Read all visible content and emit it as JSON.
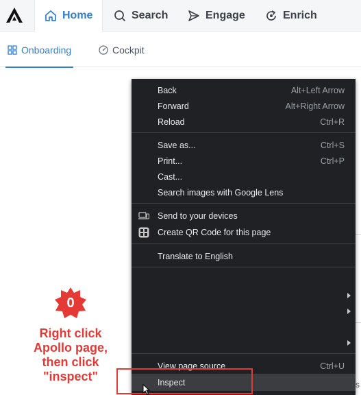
{
  "top_nav": {
    "tabs": [
      {
        "label": "Home",
        "icon": "home-icon",
        "active": true
      },
      {
        "label": "Search",
        "icon": "search-icon",
        "active": false
      },
      {
        "label": "Engage",
        "icon": "send-icon",
        "active": false
      },
      {
        "label": "Enrich",
        "icon": "refresh-icon",
        "active": false
      }
    ]
  },
  "sub_nav": {
    "tabs": [
      {
        "label": "Onboarding",
        "icon": "grid-icon",
        "active": true
      },
      {
        "label": "Cockpit",
        "icon": "gauge-icon",
        "active": false
      }
    ]
  },
  "context_menu": {
    "items": {
      "back": {
        "label": "Back",
        "shortcut": "Alt+Left Arrow"
      },
      "forward": {
        "label": "Forward",
        "shortcut": "Alt+Right Arrow"
      },
      "reload": {
        "label": "Reload",
        "shortcut": "Ctrl+R"
      },
      "save_as": {
        "label": "Save as...",
        "shortcut": "Ctrl+S"
      },
      "print": {
        "label": "Print...",
        "shortcut": "Ctrl+P"
      },
      "cast": {
        "label": "Cast..."
      },
      "lens": {
        "label": "Search images with Google Lens"
      },
      "send_devices": {
        "label": "Send to your devices",
        "icon": "devices-icon"
      },
      "qr": {
        "label": "Create QR Code for this page",
        "icon": "qr-code-icon"
      },
      "translate": {
        "label": "Translate to English"
      },
      "view_source": {
        "label": "View page source",
        "shortcut": "Ctrl+U"
      },
      "inspect": {
        "label": "Inspect"
      }
    }
  },
  "annotation": {
    "step_number": "0",
    "instruction": "Right click Apollo page, then click \"inspect\"",
    "color": "#e53935"
  },
  "background_fragment": "s"
}
